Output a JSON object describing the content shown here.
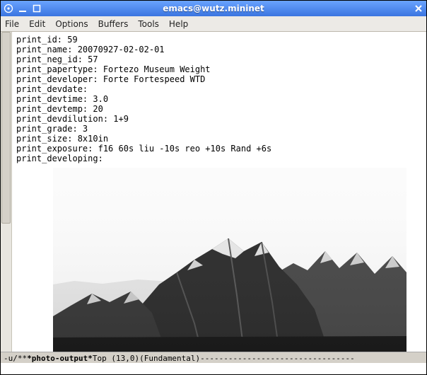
{
  "titlebar": {
    "title": "emacs@wutz.mininet"
  },
  "menubar": {
    "items": [
      "File",
      "Edit",
      "Options",
      "Buffers",
      "Tools",
      "Help"
    ]
  },
  "buffer": {
    "lines": [
      "print_id: 59",
      "print_name: 20070927-02-02-01",
      "print_neg_id: 57",
      "print_papertype: Fortezo Museum Weight",
      "print_developer: Forte Fortespeed WTD",
      "print_devdate:",
      "print_devtime: 3.0",
      "print_devtemp: 20",
      "print_devdilution: 1+9",
      "print_grade: 3",
      "print_size: 8x10in",
      "print_exposure: f16 60s liu -10s reo +10s Rand +6s",
      "print_developing:"
    ]
  },
  "modeline": {
    "left": "-u/**  ",
    "buffer_name": "*photo-output*",
    "position": "   Top (13,0)     ",
    "mode": "(Fundamental)",
    "dashes": "---------------------------------"
  },
  "minibuffer": {
    "text": ""
  }
}
